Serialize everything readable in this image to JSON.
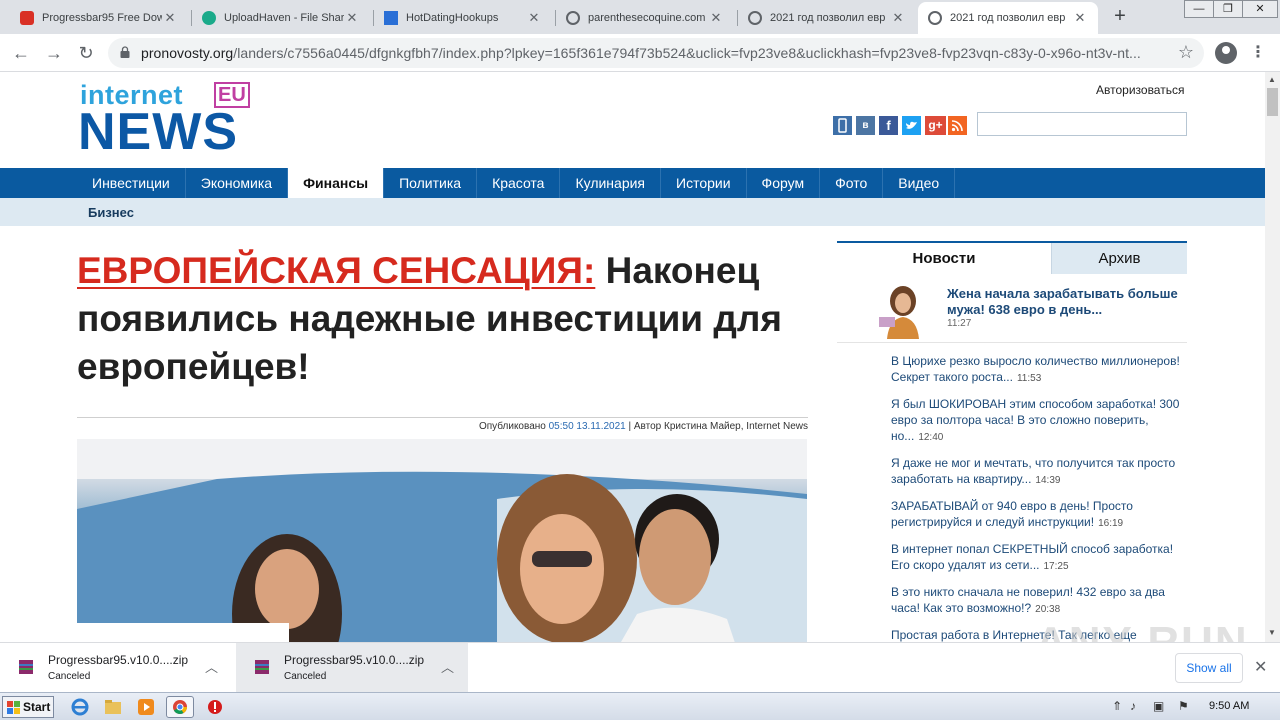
{
  "browser": {
    "tabs": [
      {
        "title": "Progressbar95 Free Dow",
        "fav_color": "#d93025",
        "active": false
      },
      {
        "title": "UploadHaven - File Shari",
        "fav_color": "#1aaa8a",
        "active": false
      },
      {
        "title": "HotDatingHookups",
        "fav_color": "#2a6fd6",
        "active": false
      },
      {
        "title": "parenthesecoquine.com",
        "fav_color": "#5f6368",
        "active": false
      },
      {
        "title": "2021 год позволил евр",
        "fav_color": "#5f6368",
        "active": false
      },
      {
        "title": "2021 год позволил евр",
        "fav_color": "#5f6368",
        "active": true
      }
    ],
    "url_host": "pronovosty.org",
    "url_path": "/landers/c7556a0445/dfgnkgfbh7/index.php?lpkey=165f361e794f73b524&uclick=fvp23ve8&uclickhash=fvp23ve8-fvp23vqn-c83y-0-x96o-nt3v-nt..."
  },
  "site": {
    "logo_top": "internet",
    "logo_eu": "EU",
    "logo_bottom": "NEWS",
    "login": "Авторизоваться",
    "social": [
      {
        "label": "▯",
        "color": "#3d6fa8",
        "name": "mobile-icon"
      },
      {
        "label": "в",
        "color": "#4c75a3",
        "name": "vk-icon"
      },
      {
        "label": "f",
        "color": "#3b5998",
        "name": "facebook-icon"
      },
      {
        "label": "t",
        "color": "#1da1f2",
        "name": "twitter-icon"
      },
      {
        "label": "g+",
        "color": "#dd4b39",
        "name": "googleplus-icon"
      },
      {
        "label": "rss",
        "color": "#f26522",
        "name": "rss-icon"
      }
    ],
    "nav": [
      "Инвестиции",
      "Экономика",
      "Финансы",
      "Политика",
      "Красота",
      "Кулинария",
      "Истории",
      "Форум",
      "Фото",
      "Видео"
    ],
    "nav_active": "Финансы",
    "subnav": "Бизнес"
  },
  "article": {
    "headline_red": "ЕВРОПЕЙСКАЯ СЕНСАЦИЯ:",
    "headline_rest": " Наконец появились надежные инвестиции для европейцев!",
    "meta_prefix": "Опубликовано ",
    "meta_date": "05:50 13.11.2021",
    "meta_author": " | Автор Кристина Майер, Internet News"
  },
  "sidebar": {
    "tab_news": "Новости",
    "tab_archive": "Архив",
    "featured_title": "Жена начала зарабатывать больше мужа! 638 евро в день...",
    "featured_time": "11:27",
    "items": [
      {
        "text": "В Цюрихе резко выросло количество миллионеров! Секрет такого роста...",
        "time": "11:53"
      },
      {
        "text": "Я был ШОКИРОВАН этим способом заработка! 300 евро за полтора часа! В это сложно поверить, но...",
        "time": "12:40"
      },
      {
        "text": "Я даже не мог и мечтать, что получится так просто заработать на квартиру...",
        "time": "14:39"
      },
      {
        "text": "ЗАРАБАТЫВАЙ от 940 евро в день! Просто регистрируйся и следуй инструкции!",
        "time": "16:19"
      },
      {
        "text": "В интернет попал СЕКРЕТНЫЙ способ заработка! Его скоро удалят из сети...",
        "time": "17:25"
      },
      {
        "text": "В это никто сначала не поверил! 432 евро за два часа! Как это возможно!?",
        "time": "20:38"
      },
      {
        "text": "Простая работа в Интернете! Так легко еще",
        "time": ""
      }
    ]
  },
  "downloads": {
    "items": [
      {
        "name": "Progressbar95.v10.0....zip",
        "status": "Canceled"
      },
      {
        "name": "Progressbar95.v10.0....zip",
        "status": "Canceled"
      }
    ],
    "show_all": "Show all"
  },
  "watermark": "ANY RUN",
  "taskbar": {
    "start": "Start",
    "clock": "9:50 AM"
  }
}
